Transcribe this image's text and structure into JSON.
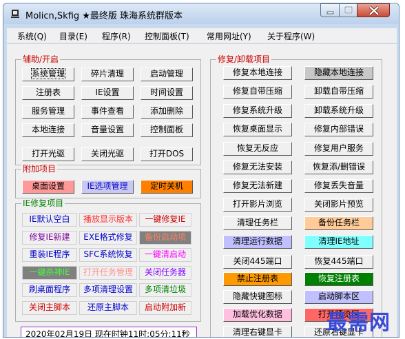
{
  "window": {
    "title": "Molicn,Skfig ★最终版 珠海系统群版本"
  },
  "menu": [
    "系统(Q)",
    "目录(E)",
    "程序(R)",
    "控制面板(T)",
    "常用网址(Y)",
    "关于程序(W)"
  ],
  "groups": {
    "assist": "辅助/开启",
    "addon": "附加项目",
    "ie": "IE修复项目",
    "repair": "修复/卸载项目"
  },
  "assist_buttons": [
    "系统管理",
    "碎片清理",
    "启动管理",
    "注册表",
    "IE设置",
    "时间设置",
    "服务管理",
    "事件查看",
    "添加删除",
    "本地连接",
    "音量设置",
    "控制面板",
    "打开光驱",
    "关闭光驱",
    "打开DOS"
  ],
  "addon_buttons": [
    {
      "label": "桌面设置",
      "color": "#ff9999",
      "text": "#000000"
    },
    {
      "label": "IE选项管理",
      "color": "#c8c8f0",
      "text": "#0000cc"
    },
    {
      "label": "定时关机",
      "color": "#ff8000",
      "text": "#000000"
    }
  ],
  "ie_buttons": [
    {
      "label": "IE默认空白",
      "color": "#f0f0f0",
      "text": "#0000cc"
    },
    {
      "label": "播放显示版本",
      "color": "#f0f0f0",
      "text": "#ff3030"
    },
    {
      "label": "一键修复IE",
      "color": "#f0f0f0",
      "text": "#cc0000"
    },
    {
      "label": "修复IE新建",
      "color": "#f0f0f0",
      "text": "#8000a0"
    },
    {
      "label": "EXE格式修复",
      "color": "#f0f0f0",
      "text": "#0000cc"
    },
    {
      "label": "备份启动项",
      "color": "#808080",
      "text": "#ff8060"
    },
    {
      "label": "重装IE程序",
      "color": "#f0f0f0",
      "text": "#0000cc"
    },
    {
      "label": "SFC系统恢复",
      "color": "#f0f0f0",
      "text": "#0000cc"
    },
    {
      "label": "一键清启动",
      "color": "#f0f0f0",
      "text": "#ff00ff"
    },
    {
      "label": "一键杀神IE",
      "color": "#808080",
      "text": "#40ff40"
    },
    {
      "label": "打开任务管理",
      "color": "#f0f0f0",
      "text": "#ff9090"
    },
    {
      "label": "关闭任务器",
      "color": "#f0f0f0",
      "text": "#8000ff"
    },
    {
      "label": "刷桌面程序",
      "color": "#f0f0f0",
      "text": "#0000cc"
    },
    {
      "label": "多项清理设置",
      "color": "#f0f0f0",
      "text": "#0000cc"
    },
    {
      "label": "多项清垃圾",
      "color": "#f0f0f0",
      "text": "#008000"
    },
    {
      "label": "关闭主脚本",
      "color": "#f0f0f0",
      "text": "#cc0000"
    },
    {
      "label": "还原主脚本",
      "color": "#f0f0f0",
      "text": "#0000cc"
    },
    {
      "label": "启动附加新",
      "color": "#f0f0f0",
      "text": "#cc0000"
    }
  ],
  "repair_buttons": [
    {
      "label": "修复本地连接",
      "color": "#f0f0f0",
      "text": "#000000"
    },
    {
      "label": "隐藏本地连接",
      "color": "#c8c8c8",
      "text": "#000000"
    },
    {
      "label": "修复自带压缩",
      "color": "#f0f0f0",
      "text": "#000000"
    },
    {
      "label": "卸载自带压缩",
      "color": "#f0f0f0",
      "text": "#000000"
    },
    {
      "label": "修复系统升级",
      "color": "#f0f0f0",
      "text": "#000000"
    },
    {
      "label": "卸载系统升级",
      "color": "#f0f0f0",
      "text": "#000000"
    },
    {
      "label": "恢复桌面显示",
      "color": "#f0f0f0",
      "text": "#000000"
    },
    {
      "label": "修复内部错误",
      "color": "#f0f0f0",
      "text": "#000000"
    },
    {
      "label": "恢复无反应",
      "color": "#f0f0f0",
      "text": "#000000"
    },
    {
      "label": "修复用户服务",
      "color": "#f0f0f0",
      "text": "#000000"
    },
    {
      "label": "修复无法安装",
      "color": "#f0f0f0",
      "text": "#000000"
    },
    {
      "label": "恢复添/删错误",
      "color": "#f0f0f0",
      "text": "#000000"
    },
    {
      "label": "修复无法新建",
      "color": "#f0f0f0",
      "text": "#000000"
    },
    {
      "label": "修复丢失音量",
      "color": "#f0f0f0",
      "text": "#000000"
    },
    {
      "label": "打开影片浏览",
      "color": "#f0f0f0",
      "text": "#000000"
    },
    {
      "label": "关闭影片预览",
      "color": "#f0f0f0",
      "text": "#000000"
    },
    {
      "label": "清理任务栏",
      "color": "#f0f0f0",
      "text": "#000000"
    },
    {
      "label": "备份任务栏",
      "color": "#ffcc99",
      "text": "#000000"
    },
    {
      "label": "清理运行数据",
      "color": "#c0c0ff",
      "text": "#000000"
    },
    {
      "label": "清理IE地址",
      "color": "#80ffff",
      "text": "#000000"
    },
    {
      "label": "关闭445端口",
      "color": "#f0f0f0",
      "text": "#000000"
    },
    {
      "label": "恢复445端口",
      "color": "#f0f0f0",
      "text": "#000000"
    },
    {
      "label": "禁止注册表",
      "color": "#ff9900",
      "text": "#000000"
    },
    {
      "label": "恢复注册表",
      "color": "#008000",
      "text": "#ffffff"
    },
    {
      "label": "隐藏快键图标",
      "color": "#f0f0f0",
      "text": "#000000"
    },
    {
      "label": "启动脚本区",
      "color": "#c0c0ff",
      "text": "#000000"
    },
    {
      "label": "加载优化数据",
      "color": "#ffc0e0",
      "text": "#000000"
    },
    {
      "label": "打开预览区",
      "color": "#ff6666",
      "text": "#000000"
    },
    {
      "label": "清理右键显卡",
      "color": "#f0f0f0",
      "text": "#000000"
    },
    {
      "label": "还原右键显卡",
      "color": "#f0f0f0",
      "text": "#000000"
    }
  ],
  "status": "2020年02月19日 现在时钟11时:05分:11秒",
  "watermark": "最需网"
}
